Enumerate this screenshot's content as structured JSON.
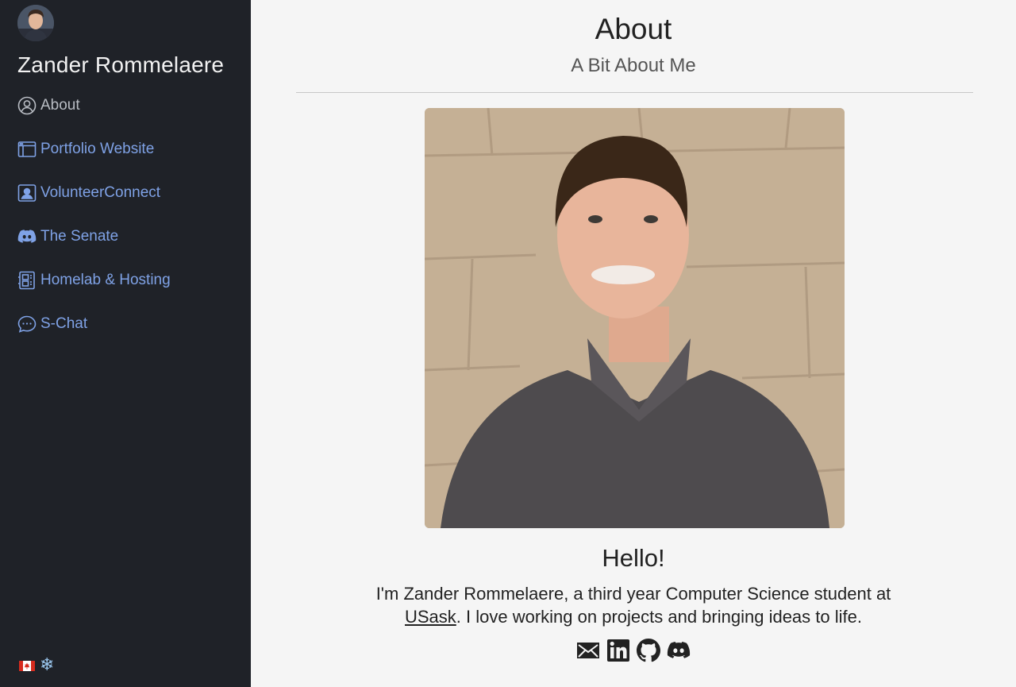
{
  "sidebar": {
    "site_name": "Zander Rommelaere",
    "nav": [
      {
        "label": "About",
        "icon": "person-circle-icon",
        "active": true
      },
      {
        "label": "Portfolio Website",
        "icon": "browser-window-icon",
        "active": false
      },
      {
        "label": "VolunteerConnect",
        "icon": "person-badge-icon",
        "active": false
      },
      {
        "label": "The Senate",
        "icon": "discord-icon",
        "active": false
      },
      {
        "label": "Homelab & Hosting",
        "icon": "server-icon",
        "active": false
      },
      {
        "label": "S-Chat",
        "icon": "chat-dots-icon",
        "active": false
      }
    ],
    "footer_icons": [
      "canada-flag-icon",
      "snowflake-icon"
    ],
    "colors": {
      "background": "#1f2228",
      "link": "#7fa2e6",
      "active": "#b9bdc4"
    }
  },
  "main": {
    "title": "About",
    "subtitle": "A Bit About Me",
    "greeting": "Hello!",
    "bio": {
      "before": "I'm Zander Rommelaere, a third year Computer Science student at ",
      "link": "USask",
      "after": ". I love working on projects and bringing ideas to life."
    },
    "socials": [
      "email-icon",
      "linkedin-icon",
      "github-icon",
      "discord-icon"
    ]
  }
}
